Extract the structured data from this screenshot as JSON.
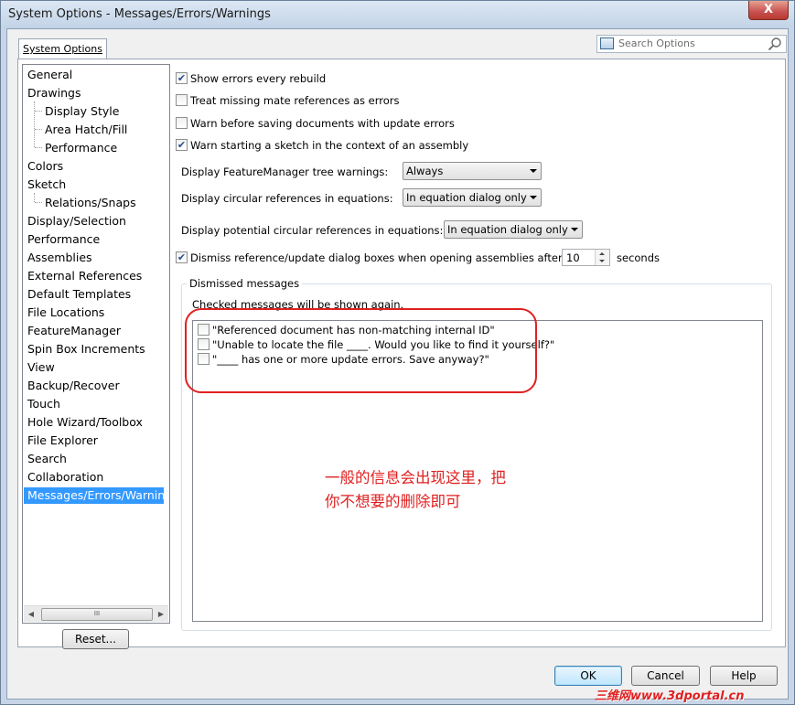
{
  "window": {
    "title": "System Options - Messages/Errors/Warnings",
    "close_glyph": "X"
  },
  "tab": {
    "label": "System Options"
  },
  "search": {
    "placeholder": "Search Options"
  },
  "tree": {
    "items": [
      {
        "label": "General",
        "sub": false
      },
      {
        "label": "Drawings",
        "sub": false
      },
      {
        "label": "Display Style",
        "sub": true
      },
      {
        "label": "Area Hatch/Fill",
        "sub": true
      },
      {
        "label": "Performance",
        "sub": true
      },
      {
        "label": "Colors",
        "sub": false
      },
      {
        "label": "Sketch",
        "sub": false
      },
      {
        "label": "Relations/Snaps",
        "sub": true
      },
      {
        "label": "Display/Selection",
        "sub": false
      },
      {
        "label": "Performance",
        "sub": false
      },
      {
        "label": "Assemblies",
        "sub": false
      },
      {
        "label": "External References",
        "sub": false
      },
      {
        "label": "Default Templates",
        "sub": false
      },
      {
        "label": "File Locations",
        "sub": false
      },
      {
        "label": "FeatureManager",
        "sub": false
      },
      {
        "label": "Spin Box Increments",
        "sub": false
      },
      {
        "label": "View",
        "sub": false
      },
      {
        "label": "Backup/Recover",
        "sub": false
      },
      {
        "label": "Touch",
        "sub": false
      },
      {
        "label": "Hole Wizard/Toolbox",
        "sub": false
      },
      {
        "label": "File Explorer",
        "sub": false
      },
      {
        "label": "Search",
        "sub": false
      },
      {
        "label": "Collaboration",
        "sub": false
      },
      {
        "label": "Messages/Errors/Warnings",
        "sub": false,
        "selected": true
      }
    ],
    "scroll_thumb_glyph": "III"
  },
  "buttons": {
    "reset": "Reset...",
    "ok": "OK",
    "cancel": "Cancel",
    "help": "Help"
  },
  "options": {
    "show_errors": {
      "label": "Show errors every rebuild",
      "checked": true
    },
    "treat_missing": {
      "label": "Treat missing mate references as errors",
      "checked": false
    },
    "warn_before_saving": {
      "label": "Warn before saving documents with update errors",
      "checked": false
    },
    "warn_sketch": {
      "label": "Warn starting a sketch in the context of an assembly",
      "checked": true
    },
    "tree_warnings_label": "Display FeatureManager tree warnings:",
    "tree_warnings_value": "Always",
    "circular_label": "Display circular references in equations:",
    "circular_value": "In equation dialog only",
    "potential_label": "Display potential circular references in equations:",
    "potential_value": "In equation dialog only",
    "dismiss_label": "Dismiss reference/update dialog boxes when opening assemblies after:",
    "dismiss_checked": true,
    "dismiss_seconds": "10",
    "seconds_label": "seconds"
  },
  "dismissed": {
    "title": "Dismissed messages",
    "hint": "Checked messages will be shown again.",
    "messages": [
      {
        "label": "\"Referenced document has non-matching internal ID\"",
        "checked": false
      },
      {
        "label": "\"Unable to locate the file ____.  Would you like to find it yourself?\"",
        "checked": false
      },
      {
        "label": "\"____ has one or more update errors.  Save anyway?\"",
        "checked": false
      }
    ]
  },
  "annotation": {
    "line1": "一般的信息会出现这里，把",
    "line2": "你不想要的删除即可"
  },
  "watermark": "三维网www.3dportal.cn",
  "colors": {
    "selection": "#3399ff",
    "annotation_red": "#e02020"
  }
}
